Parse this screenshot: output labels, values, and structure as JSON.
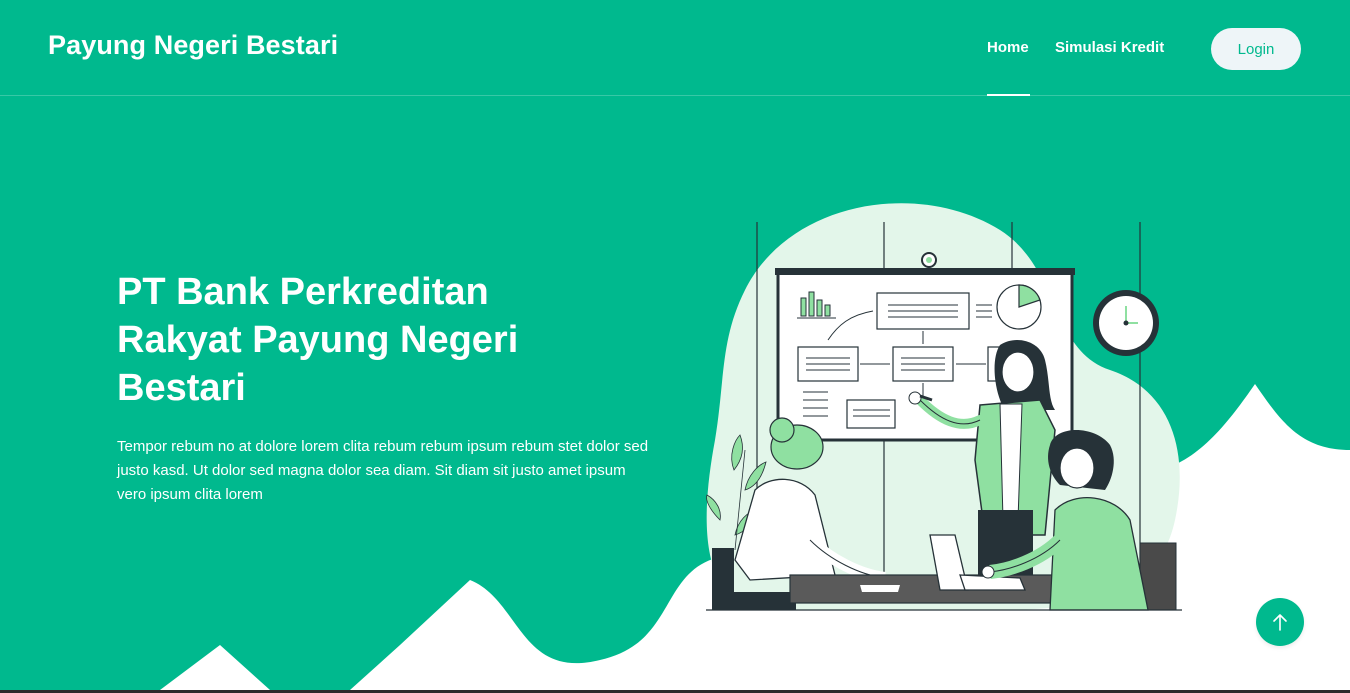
{
  "brand": "Payung Negeri Bestari",
  "nav": {
    "home": "Home",
    "simulasi": "Simulasi Kredit",
    "login": "Login"
  },
  "hero": {
    "title": "PT Bank Perkreditan Rakyat Payung Negeri Bestari",
    "text": "Tempor rebum no at dolore lorem clita rebum rebum ipsum rebum stet dolor sed justo kasd. Ut dolor sed magna dolor sea diam. Sit diam sit justo amet ipsum vero ipsum clita lorem"
  },
  "icons": {
    "back_to_top": "arrow-up-icon"
  },
  "colors": {
    "primary": "#00b98e",
    "white": "#ffffff",
    "accent_light": "#e3f6ea",
    "suit_green": "#8fe0a1",
    "dark": "#263238"
  }
}
